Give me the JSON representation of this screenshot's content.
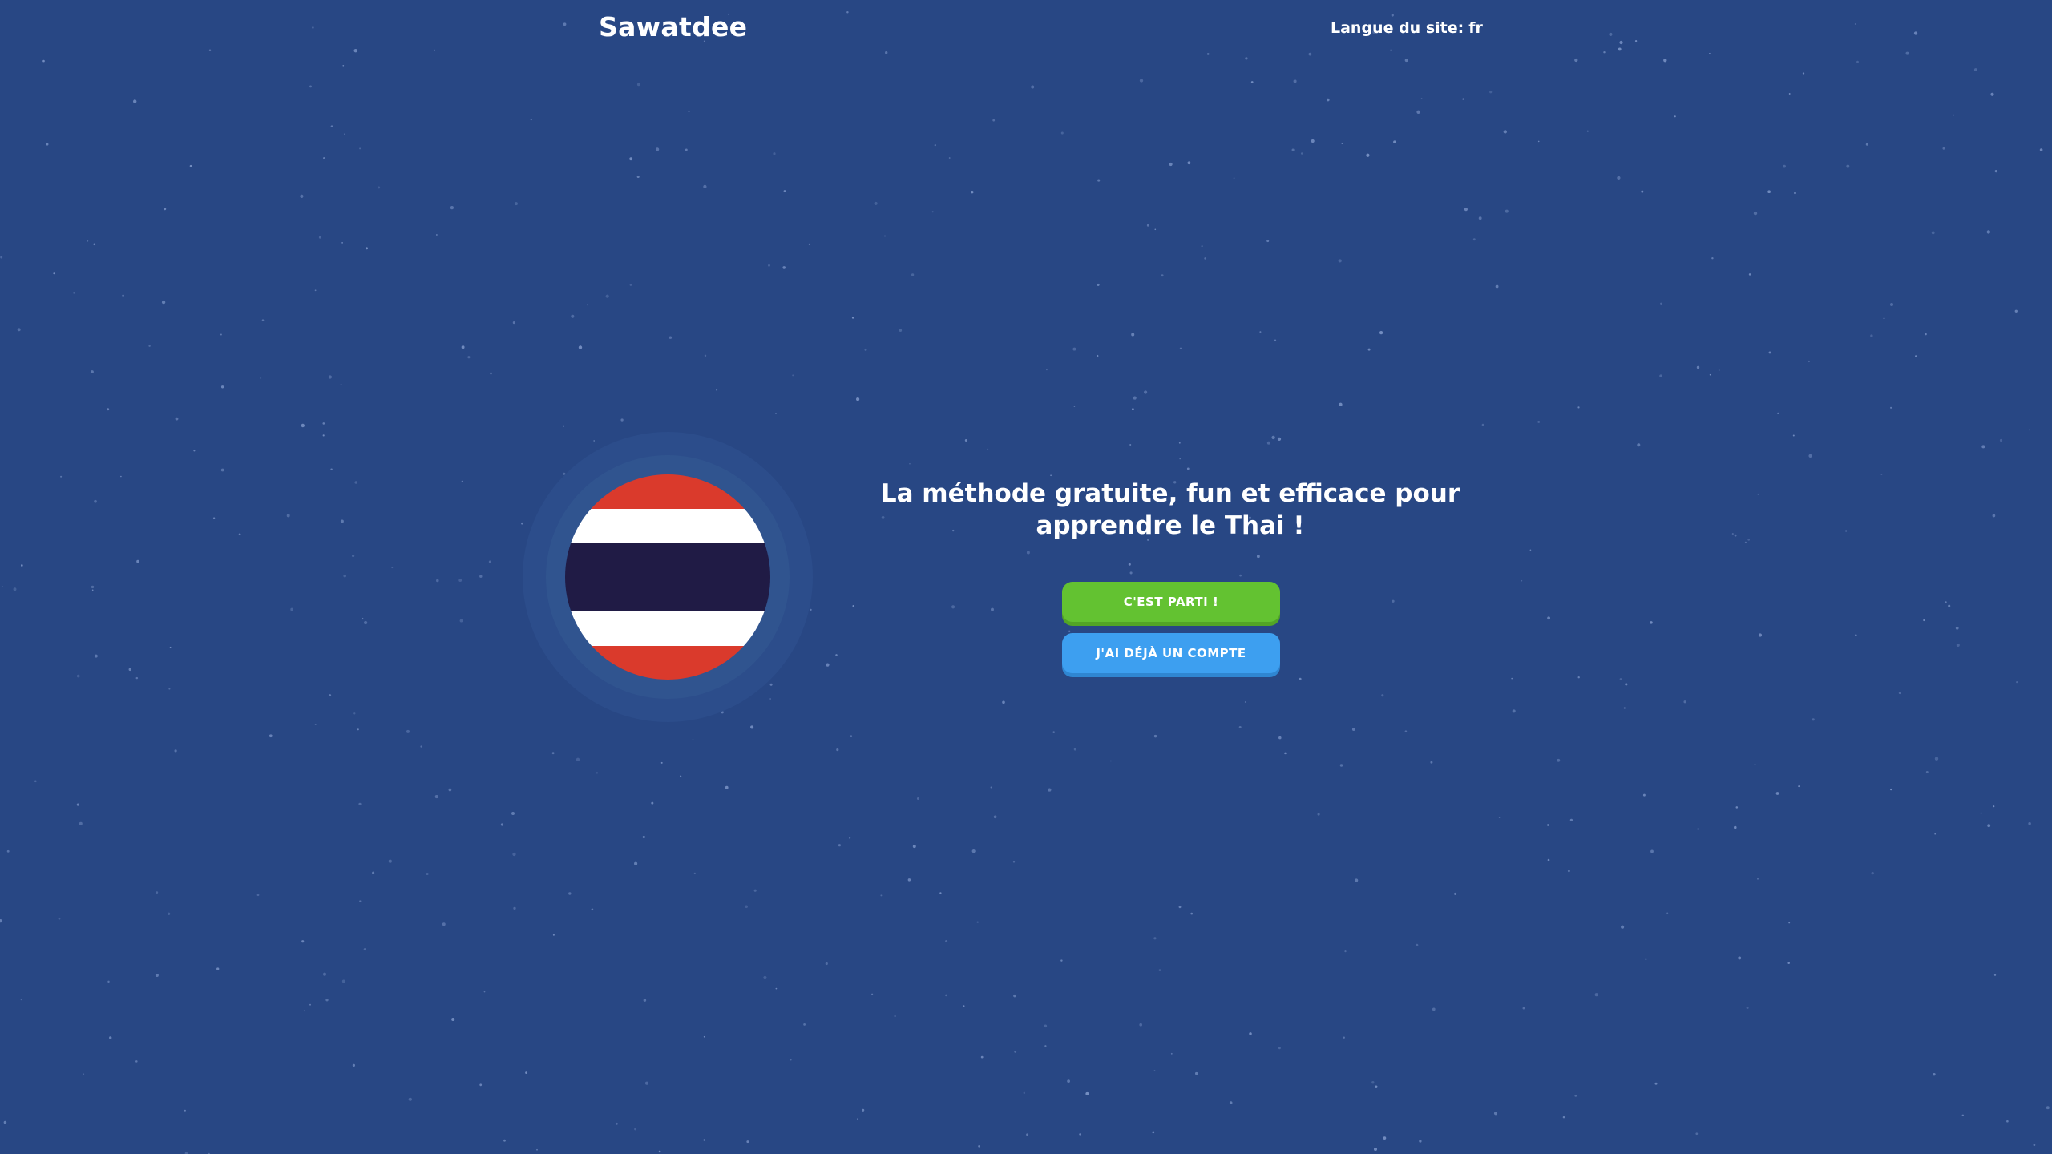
{
  "brand": {
    "name": "Sawatdee"
  },
  "header": {
    "site_language_label": "Langue du site:",
    "site_language_value": "fr"
  },
  "hero": {
    "headline": "La méthode gratuite, fun et efficace pour apprendre le Thai !",
    "start_button": "C'EST PARTI !",
    "account_button": "J'AI DÉJÀ UN COMPTE"
  },
  "flag": {
    "icon": "thailand-flag-icon",
    "colors": {
      "red": "#da3a2c",
      "white": "#ffffff",
      "navy": "#201b45"
    }
  },
  "colors": {
    "background": "#284784",
    "primary_button": "#63c231",
    "secondary_button": "#3d9ff0"
  }
}
